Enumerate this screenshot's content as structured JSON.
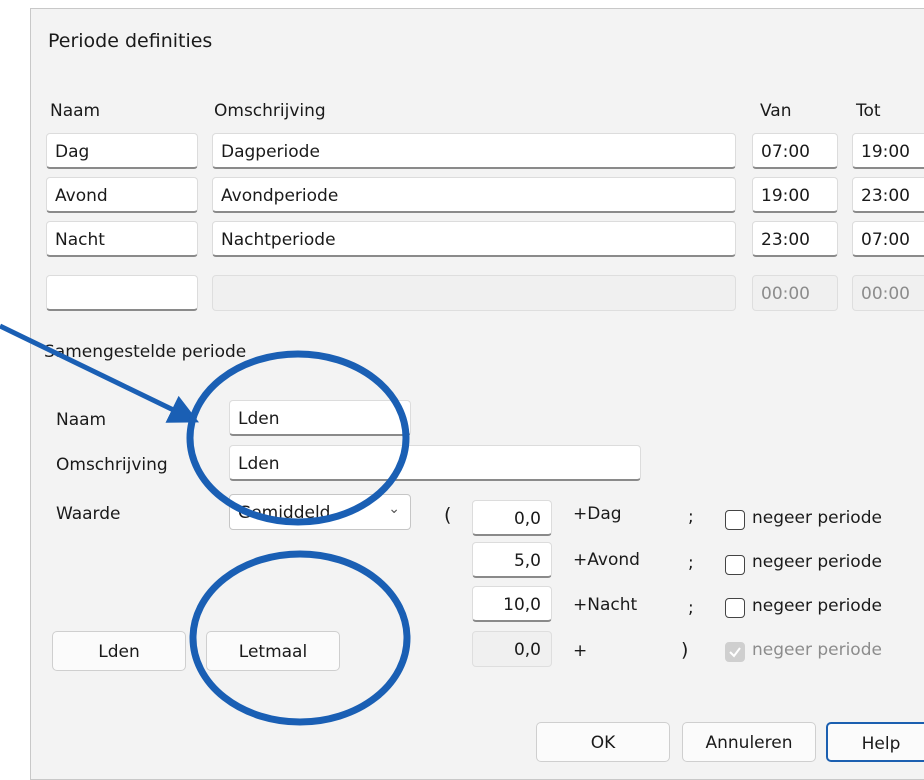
{
  "dialog": {
    "title": "Periode definities"
  },
  "columns": {
    "name": "Naam",
    "description": "Omschrijving",
    "from": "Van",
    "to": "Tot"
  },
  "periods": [
    {
      "name": "Dag",
      "description": "Dagperiode",
      "from": "07:00",
      "to": "19:00"
    },
    {
      "name": "Avond",
      "description": "Avondperiode",
      "from": "19:00",
      "to": "23:00"
    },
    {
      "name": "Nacht",
      "description": "Nachtperiode",
      "from": "23:00",
      "to": "07:00"
    },
    {
      "name": "",
      "description": "",
      "from": "00:00",
      "to": "00:00"
    }
  ],
  "composite": {
    "section_label": "Samengestelde periode",
    "name_label": "Naam",
    "name_value": "Lden",
    "description_label": "Omschrijving",
    "description_value": "Lden",
    "value_label": "Waarde",
    "value_select": "Gemiddeld",
    "open_paren": "(",
    "close_paren": ")",
    "rows": [
      {
        "value": "0,0",
        "term": "+Dag",
        "sep": ";",
        "ignore_label": "negeer periode",
        "checked": false
      },
      {
        "value": "5,0",
        "term": "+Avond",
        "sep": ";",
        "ignore_label": "negeer periode",
        "checked": false
      },
      {
        "value": "10,0",
        "term": "+Nacht",
        "sep": ";",
        "ignore_label": "negeer periode",
        "checked": false
      },
      {
        "value": "0,0",
        "term": "+",
        "sep": "",
        "ignore_label": "negeer periode",
        "checked": true,
        "disabled": true
      }
    ]
  },
  "buttons": {
    "lden": "Lden",
    "letmaal": "Letmaal",
    "ok": "OK",
    "cancel": "Annuleren",
    "help": "Help"
  },
  "annotation_color": "#1a5fb4"
}
